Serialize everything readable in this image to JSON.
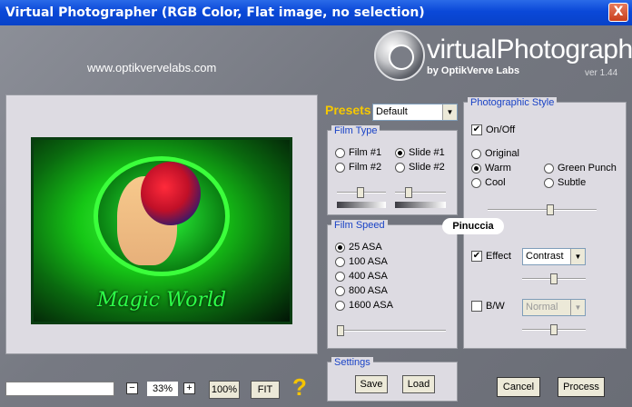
{
  "window": {
    "title": "Virtual Photographer (RGB Color, Flat image, no selection)",
    "close_glyph": "X"
  },
  "header": {
    "url": "www.optikvervelabs.com",
    "logo_text": "virtualPhotographer",
    "logo_sub": "by OptikVerve Labs",
    "version": "ver 1.44"
  },
  "preview": {
    "caption": "Magic World"
  },
  "zoom": {
    "minus": "−",
    "plus": "+",
    "value": "33%",
    "btn_100": "100%",
    "btn_fit": "FIT",
    "help": "?"
  },
  "presets": {
    "label": "Presets",
    "selected": "Default"
  },
  "film_type": {
    "title": "Film Type",
    "options": [
      {
        "label": "Film #1",
        "selected": false
      },
      {
        "label": "Slide #1",
        "selected": true
      },
      {
        "label": "Film #2",
        "selected": false
      },
      {
        "label": "Slide #2",
        "selected": false
      }
    ]
  },
  "film_speed": {
    "title": "Film Speed",
    "options": [
      {
        "label": "25 ASA",
        "selected": true
      },
      {
        "label": "100 ASA",
        "selected": false
      },
      {
        "label": "400 ASA",
        "selected": false
      },
      {
        "label": "800 ASA",
        "selected": false
      },
      {
        "label": "1600 ASA",
        "selected": false
      }
    ]
  },
  "settings": {
    "title": "Settings",
    "save": "Save",
    "load": "Load"
  },
  "photo_style": {
    "title": "Photographic Style",
    "onoff_label": "On/Off",
    "onoff_checked": true,
    "options": [
      {
        "label": "Original",
        "selected": false
      },
      {
        "label": "Warm",
        "selected": true
      },
      {
        "label": "Green Punch",
        "selected": false
      },
      {
        "label": "Cool",
        "selected": false
      },
      {
        "label": "Subtle",
        "selected": false
      }
    ],
    "effect_label": "Effect",
    "effect_checked": true,
    "effect_selected": "Contrast",
    "bw_label": "B/W",
    "bw_checked": false,
    "bw_selected": "Normal"
  },
  "watermark": "Pinuccia",
  "actions": {
    "cancel": "Cancel",
    "process": "Process"
  },
  "slider_levels": {
    "film_type_left": 0.47,
    "film_type_right": 0.22,
    "film_speed": 0.0,
    "style_strength": 0.58,
    "effect_strength": 0.5,
    "bw_strength": 0.5
  }
}
